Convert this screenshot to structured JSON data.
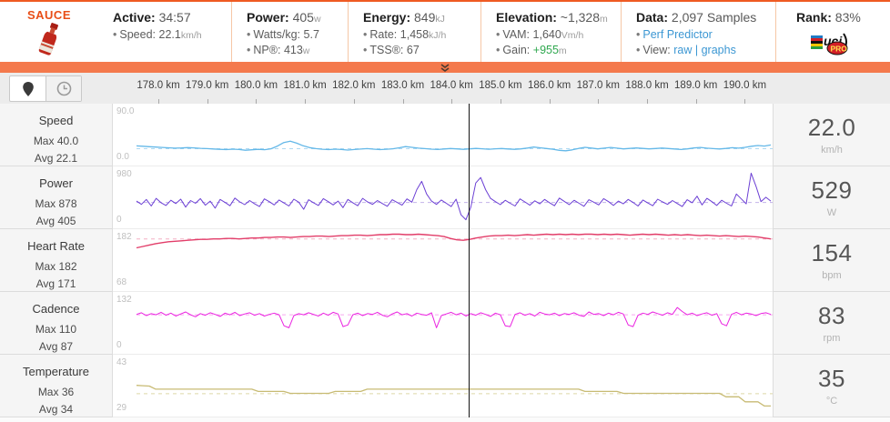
{
  "header": {
    "bullet": "•",
    "logo_text": "SAUCE",
    "active": {
      "label": "Active:",
      "value": "34:57",
      "speed_label": "Speed:",
      "speed_value": "22.1",
      "speed_unit": "km/h"
    },
    "power": {
      "label": "Power:",
      "value": "405",
      "unit": "w",
      "wkg_label": "Watts/kg:",
      "wkg_value": "5.7",
      "np_label": "NP®:",
      "np_value": "413",
      "np_unit": "w"
    },
    "energy": {
      "label": "Energy:",
      "value": "849",
      "unit": "kJ",
      "rate_label": "Rate:",
      "rate_value": "1,458",
      "rate_unit": "kJ/h",
      "tss_label": "TSS®:",
      "tss_value": "67"
    },
    "elevation": {
      "label": "Elevation:",
      "value": "~1,328",
      "unit": "m",
      "vam_label": "VAM:",
      "vam_value": "1,640",
      "vam_unit": "Vm/h",
      "gain_label": "Gain:",
      "gain_value": "+955",
      "gain_unit": "m"
    },
    "data": {
      "label": "Data:",
      "value": "2,097 Samples",
      "perf_link": "Perf Predictor",
      "view_label": "View:",
      "view_raw": "raw",
      "view_sep": "|",
      "view_graphs": "graphs"
    },
    "rank": {
      "label": "Rank:",
      "value": "83%",
      "badge_uci": "uci",
      "badge_pro": "PRO"
    }
  },
  "colors": {
    "accent_orange": "#f4794c",
    "top_border": "#ef5a22",
    "link_blue": "#3c97d3",
    "gain_green": "#2fa84f",
    "cursor": "#141414"
  },
  "chart_data": {
    "type": "line",
    "x_unit": "km",
    "x_ticks": [
      "178.0 km",
      "179.0 km",
      "180.0 km",
      "181.0 km",
      "182.0 km",
      "183.0 km",
      "184.0 km",
      "185.0 km",
      "186.0 km",
      "187.0 km",
      "188.0 km",
      "189.0 km",
      "190.0 km"
    ],
    "x_range": [
      177.1,
      190.2
    ],
    "cursor_km": 184.37,
    "grid": false,
    "legend": "left-panel",
    "series": [
      {
        "name": "Speed",
        "max_label": "Max 40.0",
        "avg_label": "Avg 22.1",
        "ytop_label": "90.0",
        "ybot_label": "0.0",
        "ylim": [
          0,
          90
        ],
        "avg": 22.1,
        "color": "#64b8e8",
        "avg_color": "#aed9f2",
        "stroke": 1.3,
        "current": "22.0",
        "unit": "km/h",
        "values": [
          26.8,
          26.2,
          25.5,
          24.8,
          24.2,
          23.6,
          23.0,
          23.4,
          23.9,
          23.5,
          22.8,
          22.2,
          21.6,
          21.0,
          20.6,
          21.3,
          20.8,
          19.6,
          20.3,
          21.0,
          20.4,
          22.0,
          26.5,
          32.5,
          34.8,
          31.5,
          27.0,
          24.0,
          22.3,
          21.2,
          20.6,
          21.4,
          20.8,
          19.9,
          20.7,
          21.5,
          22.2,
          21.4,
          20.6,
          21.2,
          22.0,
          23.6,
          25.6,
          24.4,
          23.0,
          22.2,
          21.4,
          20.8,
          21.6,
          22.4,
          21.8,
          21.0,
          21.8,
          22.6,
          22.0,
          21.2,
          21.9,
          22.5,
          21.7,
          21.0,
          21.8,
          23.2,
          24.8,
          23.6,
          22.4,
          21.2,
          19.4,
          18.6,
          20.2,
          22.6,
          24.4,
          23.2,
          21.8,
          23.0,
          24.2,
          23.0,
          21.8,
          22.6,
          23.4,
          22.6,
          21.8,
          22.4,
          23.2,
          22.4,
          21.6,
          20.8,
          21.8,
          23.4,
          24.2,
          23.0,
          22.2,
          21.6,
          22.6,
          23.8,
          23.0,
          24.4,
          26.2,
          27.4,
          26.6,
          28.4
        ]
      },
      {
        "name": "Power",
        "max_label": "Max 878",
        "avg_label": "Avg 405",
        "ytop_label": "980",
        "ybot_label": "0",
        "ylim": [
          0,
          980
        ],
        "avg": 405,
        "color": "#6b3fd4",
        "avg_color": "#c3b2ea",
        "stroke": 1,
        "current": "529",
        "unit": "W",
        "values": [
          430,
          370,
          460,
          340,
          480,
          400,
          350,
          445,
          385,
          465,
          320,
          440,
          390,
          475,
          355,
          430,
          300,
          460,
          405,
          345,
          485,
          415,
          365,
          440,
          380,
          330,
          470,
          420,
          360,
          450,
          395,
          340,
          465,
          410,
          280,
          455,
          400,
          350,
          475,
          420,
          360,
          430,
          310,
          460,
          400,
          345,
          480,
          415,
          370,
          440,
          385,
          335,
          455,
          405,
          355,
          470,
          410,
          640,
          790,
          560,
          430,
          370,
          450,
          390,
          330,
          465,
          180,
          90,
          320,
          760,
          860,
          640,
          480,
          420,
          365,
          445,
          390,
          340,
          470,
          415,
          355,
          435,
          380,
          460,
          400,
          345,
          485,
          425,
          365,
          445,
          390,
          335,
          455,
          410,
          360,
          475,
          420,
          350,
          430,
          380,
          460,
          405,
          340,
          450,
          395,
          345,
          465,
          415,
          370,
          440,
          385,
          330,
          455,
          400,
          520,
          360,
          480,
          420,
          350,
          445,
          390,
          340,
          560,
          470,
          380,
          940,
          700,
          420,
          500,
          430
        ]
      },
      {
        "name": "Heart Rate",
        "max_label": "Max 182",
        "avg_label": "Avg 171",
        "ytop_label": "182",
        "ybot_label": "68",
        "ylim": [
          68,
          182
        ],
        "avg": 171,
        "color": "#e23d69",
        "avg_color": "#f3afc4",
        "stroke": 1.4,
        "current": "154",
        "unit": "bpm",
        "values": [
          152,
          155,
          158,
          161,
          163,
          165,
          166,
          167,
          168,
          169,
          170,
          170,
          171,
          171,
          172,
          172,
          171,
          172,
          173,
          173,
          174,
          174,
          175,
          175,
          174,
          175,
          176,
          176,
          177,
          177,
          176,
          177,
          178,
          178,
          179,
          179,
          178,
          179,
          180,
          180,
          181,
          181,
          180,
          180,
          181,
          180,
          179,
          178,
          176,
          172,
          169,
          168,
          170,
          173,
          175,
          177,
          178,
          178,
          179,
          178,
          179,
          180,
          179,
          180,
          181,
          180,
          181,
          180,
          181,
          180,
          181,
          181,
          180,
          181,
          180,
          181,
          180,
          179,
          180,
          181,
          180,
          181,
          180,
          179,
          180,
          179,
          180,
          179,
          178,
          179,
          178,
          177,
          178,
          177,
          176,
          177,
          176,
          175,
          173,
          171
        ]
      },
      {
        "name": "Cadence",
        "max_label": "Max 110",
        "avg_label": "Avg 87",
        "ytop_label": "132",
        "ybot_label": "0",
        "ylim": [
          0,
          132
        ],
        "avg": 87,
        "color": "#ea21e0",
        "avg_color": "#f6a7ef",
        "stroke": 1,
        "current": "83",
        "unit": "rpm",
        "values": [
          88,
          92,
          85,
          90,
          87,
          93,
          86,
          91,
          84,
          89,
          94,
          87,
          82,
          90,
          86,
          92,
          88,
          83,
          91,
          87,
          93,
          85,
          89,
          92,
          86,
          90,
          84,
          88,
          91,
          87,
          60,
          55,
          85,
          90,
          87,
          92,
          88,
          84,
          91,
          86,
          93,
          89,
          58,
          62,
          87,
          91,
          85,
          90,
          88,
          93,
          86,
          82,
          89,
          94,
          87,
          90,
          84,
          91,
          88,
          86,
          92,
          55,
          85,
          89,
          93,
          87,
          91,
          84,
          90,
          86,
          92,
          88,
          83,
          91,
          87,
          60,
          58,
          88,
          92,
          86,
          90,
          84,
          93,
          89,
          87,
          91,
          85,
          90,
          88,
          92,
          86,
          83,
          94,
          88,
          90,
          85,
          91,
          87,
          93,
          89,
          62,
          58,
          86,
          91,
          88,
          94,
          90,
          86,
          92,
          88,
          105,
          95,
          87,
          91,
          85,
          89,
          92,
          86,
          90,
          65,
          60,
          88,
          93,
          87,
          91,
          89,
          85,
          90,
          92,
          88
        ]
      },
      {
        "name": "Temperature",
        "max_label": "Max 36",
        "avg_label": "Avg 34",
        "ytop_label": "43",
        "ybot_label": "29",
        "ylim": [
          29,
          43
        ],
        "avg": 34,
        "color": "#c8bb74",
        "avg_color": "#ded7a6",
        "stroke": 1.3,
        "current": "35",
        "unit": "°C",
        "values": [
          36.2,
          36.1,
          36.0,
          35.2,
          35.2,
          35.2,
          35.2,
          35.2,
          35.2,
          35.2,
          35.2,
          35.2,
          35.2,
          35.2,
          35.2,
          35.2,
          35.2,
          35.2,
          35.2,
          34.6,
          34.6,
          34.6,
          34.6,
          34.6,
          34.1,
          34.1,
          34.1,
          34.1,
          34.1,
          34.1,
          34.1,
          34.6,
          34.6,
          34.6,
          34.6,
          34.6,
          35.2,
          35.2,
          35.2,
          35.2,
          35.2,
          35.2,
          35.2,
          35.2,
          35.2,
          35.2,
          35.2,
          35.2,
          35.2,
          35.2,
          35.2,
          35.2,
          35.2,
          35.2,
          35.2,
          35.2,
          35.2,
          35.2,
          35.2,
          35.2,
          35.2,
          35.2,
          35.2,
          35.2,
          35.2,
          35.2,
          35.2,
          35.2,
          35.2,
          35.2,
          34.6,
          34.6,
          34.6,
          34.6,
          34.6,
          34.6,
          34.1,
          34.1,
          34.1,
          34.1,
          34.1,
          34.1,
          34.1,
          34.1,
          34.1,
          34.1,
          34.1,
          34.1,
          34.1,
          34.1,
          34.1,
          34.1,
          33.2,
          33.2,
          33.2,
          31.9,
          31.9,
          31.9,
          30.8,
          30.8
        ]
      }
    ]
  }
}
